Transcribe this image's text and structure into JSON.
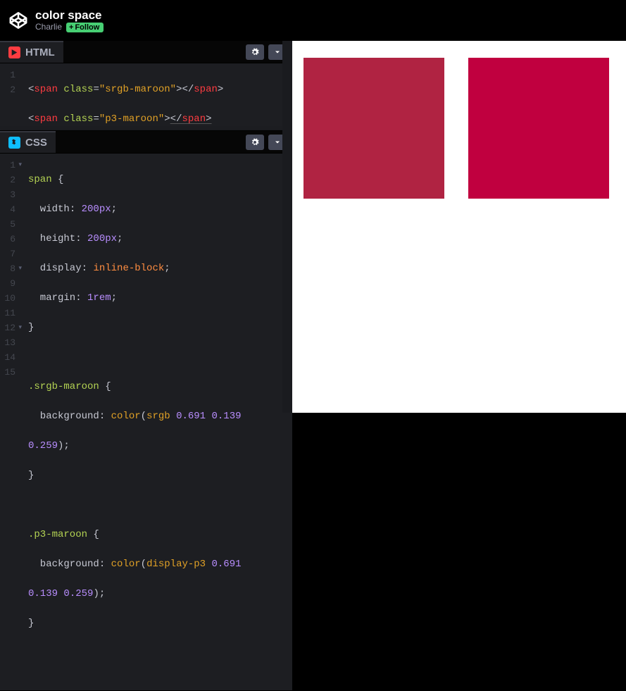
{
  "header": {
    "pen_title": "color space",
    "author": "Charlie",
    "follow_label": "Follow"
  },
  "panels": {
    "html": {
      "label": "HTML"
    },
    "css": {
      "label": "CSS"
    }
  },
  "gutter": {
    "html": [
      "1",
      "2"
    ],
    "css": [
      "1",
      "2",
      "3",
      "4",
      "5",
      "6",
      "7",
      "8",
      "9",
      "10",
      "11",
      "12",
      "13",
      "14",
      "15"
    ]
  },
  "html_code": {
    "l1": {
      "tag_open": "<span ",
      "attr": "class",
      "eq": "=",
      "str": "\"srgb-maroon\"",
      "tag_mid": ">",
      "close": "</span>"
    },
    "l2": {
      "tag_open": "<span ",
      "attr": "class",
      "eq": "=",
      "str": "\"p3-maroon\"",
      "tag_mid": ">",
      "close": "</span>"
    }
  },
  "css_code": {
    "l1_sel": "span ",
    "l1_br": "{",
    "l2_p": "  width",
    "l2_c": ": ",
    "l2_v": "200px",
    "l2_e": ";",
    "l3_p": "  height",
    "l3_c": ": ",
    "l3_v": "200px",
    "l3_e": ";",
    "l4_p": "  display",
    "l4_c": ": ",
    "l4_v": "inline-block",
    "l4_e": ";",
    "l5_p": "  margin",
    "l5_c": ": ",
    "l5_v": "1rem",
    "l5_e": ";",
    "l6": "}",
    "l7": "",
    "l8_sel": ".srgb-maroon ",
    "l8_br": "{",
    "l9_p": "  background",
    "l9_c": ": ",
    "l9_fn": "color",
    "l9_paren": "(",
    "l9_space": "srgb ",
    "l9_n1": "0.691 ",
    "l9_n2": "0.139 ",
    "l9b_n3": "0.259",
    "l9b_end": ");",
    "l10": "}",
    "l11": "",
    "l12_sel": ".p3-maroon ",
    "l12_br": "{",
    "l13_p": "  background",
    "l13_c": ": ",
    "l13_fn": "color",
    "l13_paren": "(",
    "l13_space": "display-p3 ",
    "l13_n1": "0.691 ",
    "l13b_n2": "0.139 ",
    "l13b_n3": "0.259",
    "l13b_end": ");",
    "l14": "}",
    "l15": ""
  },
  "preview": {
    "swatch1_class": "srgb-maroon",
    "swatch2_class": "p3-maroon"
  },
  "icons": {
    "gear": "gear-icon",
    "chevron": "chevron-down-icon",
    "logo": "codepen-logo-icon"
  }
}
